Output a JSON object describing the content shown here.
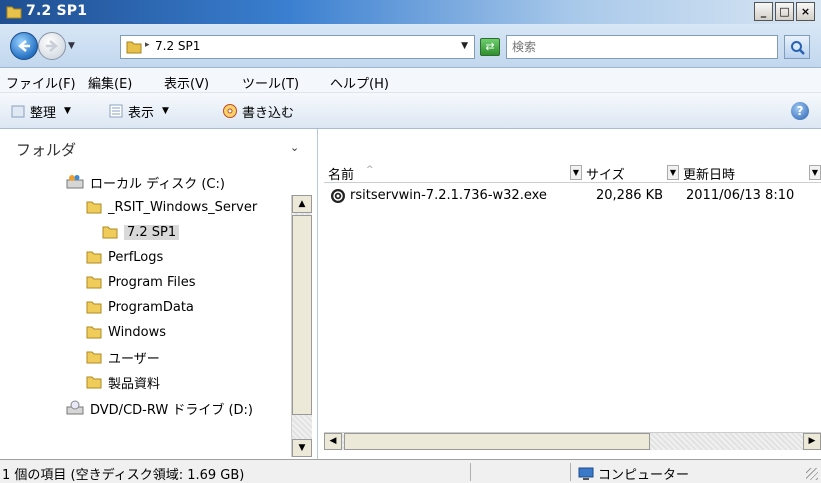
{
  "window": {
    "title": "7.2 SP1",
    "min": "_",
    "max": "□",
    "close": "×"
  },
  "address": {
    "crumb": "7.2 SP1",
    "search_placeholder": "検索"
  },
  "menu": [
    "ファイル(F)",
    "編集(E)",
    "表示(V)",
    "ツール(T)",
    "ヘルプ(H)"
  ],
  "toolbar": {
    "organize": "整理",
    "view": "表示",
    "burn": "書き込む",
    "help": "?"
  },
  "folders": {
    "header": "フォルダ",
    "items": [
      {
        "label": "ローカル ディスク (C:)",
        "icon": "local-disk-icon"
      },
      {
        "label": "_RSIT_Windows_Server",
        "icon": "folder-icon"
      },
      {
        "label": "7.2 SP1",
        "icon": "folder-icon",
        "selected": true
      },
      {
        "label": "PerfLogs",
        "icon": "folder-icon"
      },
      {
        "label": "Program Files",
        "icon": "folder-icon"
      },
      {
        "label": "ProgramData",
        "icon": "folder-icon"
      },
      {
        "label": "Windows",
        "icon": "folder-icon"
      },
      {
        "label": "ユーザー",
        "icon": "folder-icon"
      },
      {
        "label": "製品資料",
        "icon": "folder-icon"
      },
      {
        "label": "DVD/CD-RW ドライブ (D:)",
        "icon": "dvd-drive-icon"
      }
    ]
  },
  "columns": {
    "name": "名前",
    "size": "サイズ",
    "modified": "更新日時"
  },
  "files": [
    {
      "name": "rsitservwin-7.2.1.736-w32.exe",
      "size": "20,286 KB",
      "modified": "2011/06/13 8:10"
    }
  ],
  "status": {
    "left": "1 個の項目 (空きディスク領域: 1.69 GB)",
    "right": "コンピューター"
  }
}
